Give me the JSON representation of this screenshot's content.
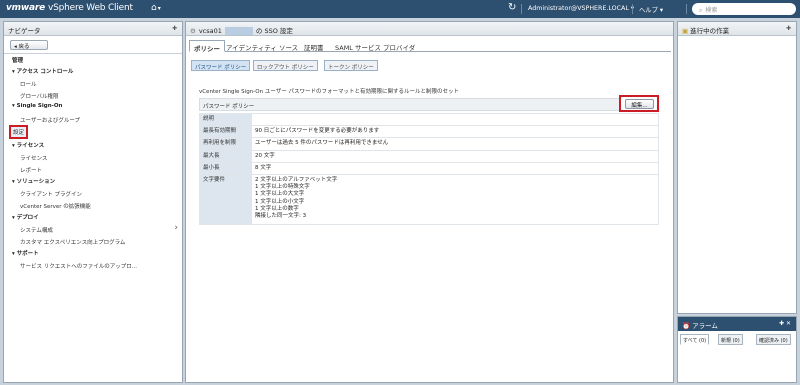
{
  "app": {
    "brand": "vmware",
    "product": "vSphere Web Client"
  },
  "topbar": {
    "home_icon": "home-icon",
    "user": "Administrator@VSPHERE.LOCAL ▾",
    "help": "ヘルプ ▾",
    "search_placeholder": "検索"
  },
  "navigator": {
    "title": "ナビゲータ",
    "back": "戻る",
    "items": [
      {
        "label": "管理"
      },
      {
        "label": "▾ アクセス コントロール"
      },
      {
        "label": "ロール"
      },
      {
        "label": "グローバル権限"
      },
      {
        "label": "▾ Single Sign-On"
      },
      {
        "label": "ユーザーおよびグループ"
      },
      {
        "label": "設定"
      },
      {
        "label": "▾ ライセンス"
      },
      {
        "label": "ライセンス"
      },
      {
        "label": "レポート"
      },
      {
        "label": "▾ ソリューション"
      },
      {
        "label": "クライアント プラグイン"
      },
      {
        "label": "vCenter Server の拡張機能"
      },
      {
        "label": "▾ デプロイ"
      },
      {
        "label": "システム構成"
      },
      {
        "label": "カスタマ エクスペリエンス向上プログラム"
      },
      {
        "label": "▾ サポート"
      },
      {
        "label": "サービス リクエストへのファイルのアップロ..."
      }
    ]
  },
  "main": {
    "title_prefix": "vcsa01",
    "title_suffix": "の SSO 設定",
    "tabs": [
      "ポリシー",
      "アイデンティティ ソース",
      "証明書",
      "SAML サービス プロバイダ"
    ],
    "subtabs": [
      "パスワード ポリシー",
      "ロックアウト ポリシー",
      "トークン ポリシー"
    ],
    "description": "vCenter Single Sign-On ユーザー パスワードのフォーマットと有効期限に関するルールと制限のセット",
    "policy_label": "パスワード ポリシー",
    "edit_button": "編集...",
    "rows": [
      {
        "key": "説明",
        "value": ""
      },
      {
        "key": "最長有効期間",
        "value": "90 日ごとにパスワードを変更する必要があります"
      },
      {
        "key": "再利用を制限",
        "value": "ユーザーは過去 5 件のパスワードは再利用できません"
      },
      {
        "key": "最大長",
        "value": "20 文字"
      },
      {
        "key": "最小長",
        "value": "8 文字"
      }
    ],
    "requirements_label": "文字要件",
    "requirements": [
      "2 文字以上のアルファベット文字",
      "1 文字以上の特殊文字",
      "1 文字以上の大文字",
      "1 文字以上の小文字",
      "1 文字以上の数字",
      "隣接した同一文字: 3"
    ]
  },
  "tasks": {
    "title": "進行中の作業"
  },
  "alarms": {
    "title": "アラーム",
    "tabs": [
      "すべて (0)",
      "新規 (0)",
      "確認済み (0)"
    ]
  }
}
